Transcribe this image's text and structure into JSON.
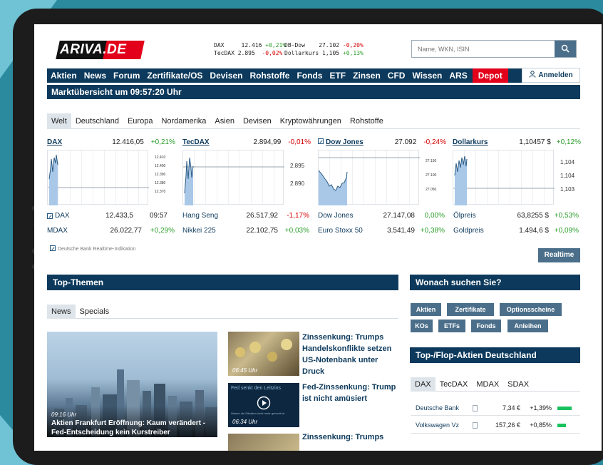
{
  "header": {
    "logo_prefix": "ARIVA",
    "logo_suffix": ".DE",
    "ticker": [
      {
        "name": "DAX",
        "value": "12.416",
        "change": "+0,21%",
        "dir": "up"
      },
      {
        "name": "TecDAX",
        "value": "2.895",
        "change": "-0,02%",
        "dir": "down"
      },
      {
        "name": "DB-Dow",
        "value": "27.102",
        "change": "-0,20%",
        "dir": "down"
      },
      {
        "name": "Dollarkurs",
        "value": "1,105",
        "change": "+0,13%",
        "dir": "up"
      }
    ],
    "search_placeholder": "Name, WKN, ISIN",
    "search_icon": "search-icon",
    "login_label": "Anmelden"
  },
  "nav": [
    "Aktien",
    "News",
    "Forum",
    "Zertifikate/OS",
    "Devisen",
    "Rohstoffe",
    "Fonds",
    "ETF",
    "Zinsen",
    "CFD",
    "Wissen",
    "ARS"
  ],
  "nav_depot": "Depot",
  "market": {
    "title": "Marktübersicht um 09:57:20 Uhr",
    "tabs": [
      "Welt",
      "Deutschland",
      "Europa",
      "Nordamerika",
      "Asien",
      "Devisen",
      "Kryptowährungen",
      "Rohstoffe"
    ],
    "charts": [
      {
        "name": "DAX",
        "value": "12.416,05",
        "change": "+0,21%",
        "dir": "up",
        "yticks": [
          "12.410",
          "12.400",
          "12.390",
          "12.380",
          "12.370"
        ]
      },
      {
        "name": "TecDAX",
        "value": "2.894,99",
        "change": "-0,01%",
        "dir": "down",
        "yticks": [
          "2.895",
          "2.890"
        ]
      },
      {
        "name": "Dow Jones",
        "value": "27.092",
        "change": "-0,24%",
        "dir": "down",
        "yticks": [
          "27.150",
          "27.100",
          "27.050"
        ]
      },
      {
        "name": "Dollarkurs",
        "value": "1,10457 $",
        "change": "+0,12%",
        "dir": "up",
        "yticks": [
          "1,104",
          "1,104",
          "1,103"
        ]
      }
    ],
    "quotes": [
      [
        {
          "name": "DAX",
          "value": "12.433,5",
          "extra": "09:57",
          "dir": "none"
        },
        {
          "name": "Hang Seng",
          "value": "26.517,92",
          "extra": "-1,17%",
          "dir": "down"
        },
        {
          "name": "Dow Jones",
          "value": "27.147,08",
          "extra": "0,00%",
          "dir": "up"
        },
        {
          "name": "Ölpreis",
          "value": "63,8255 $",
          "extra": "+0,53%",
          "dir": "up"
        }
      ],
      [
        {
          "name": "MDAX",
          "value": "26.022,77",
          "extra": "+0,29%",
          "dir": "up"
        },
        {
          "name": "Nikkei 225",
          "value": "22.102,75",
          "extra": "+0,03%",
          "dir": "up"
        },
        {
          "name": "Euro Stoxx 50",
          "value": "3.541,49",
          "extra": "+0,38%",
          "dir": "up"
        },
        {
          "name": "Goldpreis",
          "value": "1.494,6 $",
          "extra": "+0,09%",
          "dir": "up"
        }
      ]
    ],
    "realtime_note": "Deutsche Bank Realtime-Indikation",
    "realtime_button": "Realtime"
  },
  "top_themen": {
    "title": "Top-Themen",
    "tabs": [
      "News",
      "Specials"
    ],
    "hero": {
      "time": "09:16 Uhr",
      "title": "Aktien Frankfurt Eröffnung: Kaum verändert - Fed-Entscheidung kein Kurstreiber"
    },
    "items": [
      {
        "time": "06:45 Uhr",
        "title": "Zinssenkung: Trumps Handelskonflikte setzen US-Notenbank unter Druck"
      },
      {
        "time": "06:34 Uhr",
        "title": "Fed-Zinssenkung: Trump ist nicht amüsiert",
        "thumb_caption": "Fed senkt den Leitzins",
        "thumb_sub": "Warum die Situation nicht mehr gerecht ist"
      },
      {
        "time": "",
        "title": "Zinssenkung: Trumps"
      }
    ]
  },
  "wonach": {
    "title": "Wonach suchen Sie?",
    "pills": [
      "Aktien",
      "Zertifikate",
      "Optionsscheine",
      "KOs",
      "ETFs",
      "Fonds",
      "Anleihen"
    ]
  },
  "topflop": {
    "title": "Top-/Flop-Aktien Deutschland",
    "tabs": [
      "DAX",
      "TecDAX",
      "MDAX",
      "SDAX"
    ],
    "rows": [
      {
        "name": "Deutsche Bank",
        "price": "7,34 €",
        "change": "+1,39%",
        "bar": 1.0
      },
      {
        "name": "Volkswagen Vz",
        "price": "157,26 €",
        "change": "+0,85%",
        "bar": 0.6
      }
    ]
  }
}
